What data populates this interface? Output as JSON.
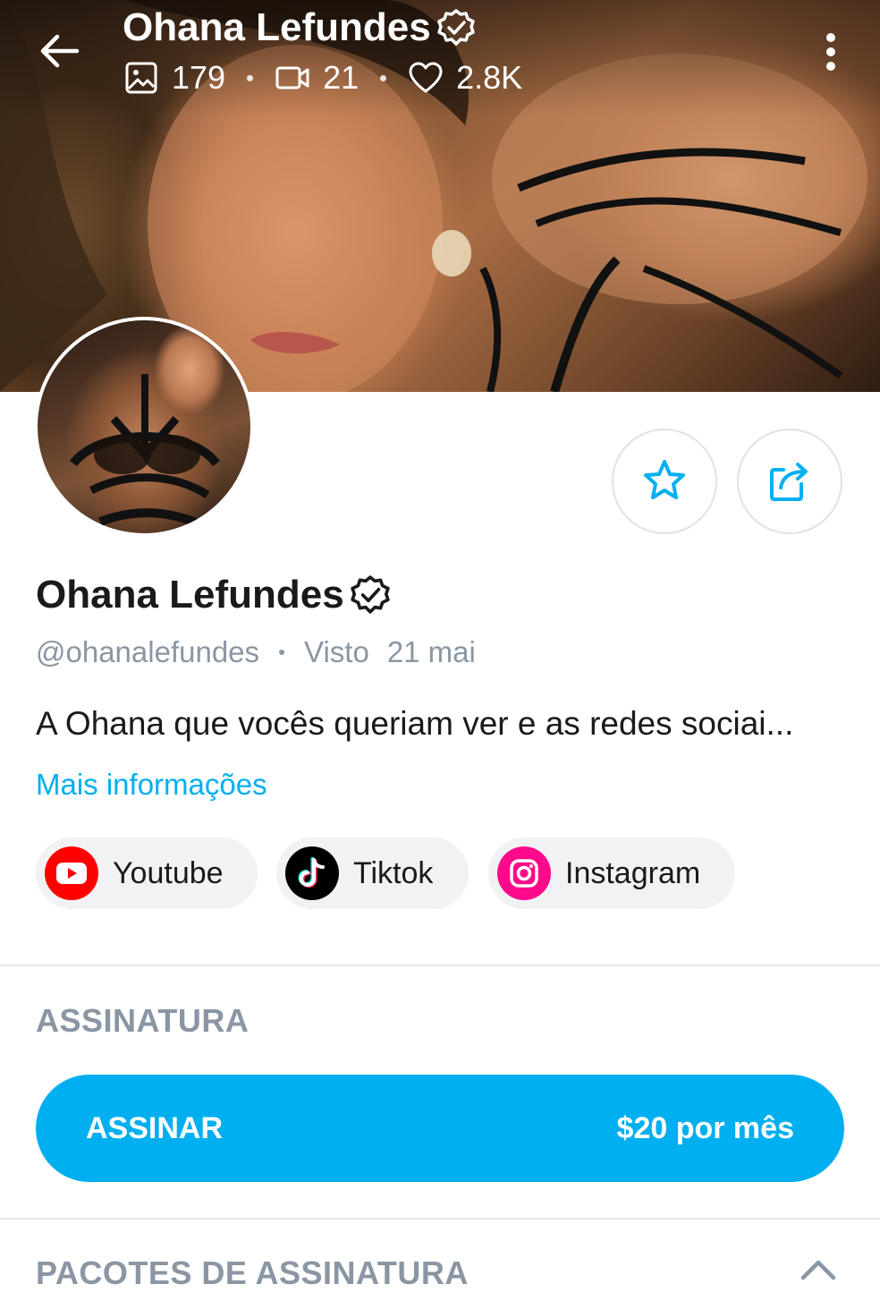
{
  "header": {
    "title": "Ohana Lefundes",
    "stats": {
      "photos": "179",
      "videos": "21",
      "likes": "2.8K"
    },
    "icons": {
      "back": "arrow-left-icon",
      "more": "more-vertical-icon",
      "photos": "image-icon",
      "videos": "video-icon",
      "likes": "heart-icon",
      "verified": "verified-badge-icon"
    }
  },
  "profile": {
    "name": "Ohana Lefundes",
    "handle": "@ohanalefundes",
    "seen_label": "Visto",
    "seen_date": "21 mai",
    "bio": "A Ohana que vocês queriam ver e as redes sociai...",
    "more_info": "Mais informações"
  },
  "actions": {
    "favorite_icon": "star-icon",
    "share_icon": "share-icon"
  },
  "social_links": [
    {
      "label": "Youtube",
      "icon": "youtube-icon",
      "color": "#ff0000"
    },
    {
      "label": "Tiktok",
      "icon": "tiktok-icon",
      "color": "#000000"
    },
    {
      "label": "Instagram",
      "icon": "instagram-icon",
      "color": "#ff0a8a"
    }
  ],
  "subscription": {
    "section_title": "ASSINATURA",
    "button_label": "ASSINAR",
    "price": "$20 por mês"
  },
  "bundles": {
    "section_title": "PACOTES DE ASSINATURA",
    "toggle_icon": "chevron-up-icon"
  },
  "colors": {
    "accent": "#00aff0",
    "muted_text": "#8a96a3",
    "text": "#1a1a1a",
    "chip_bg": "#f1f2f4"
  }
}
